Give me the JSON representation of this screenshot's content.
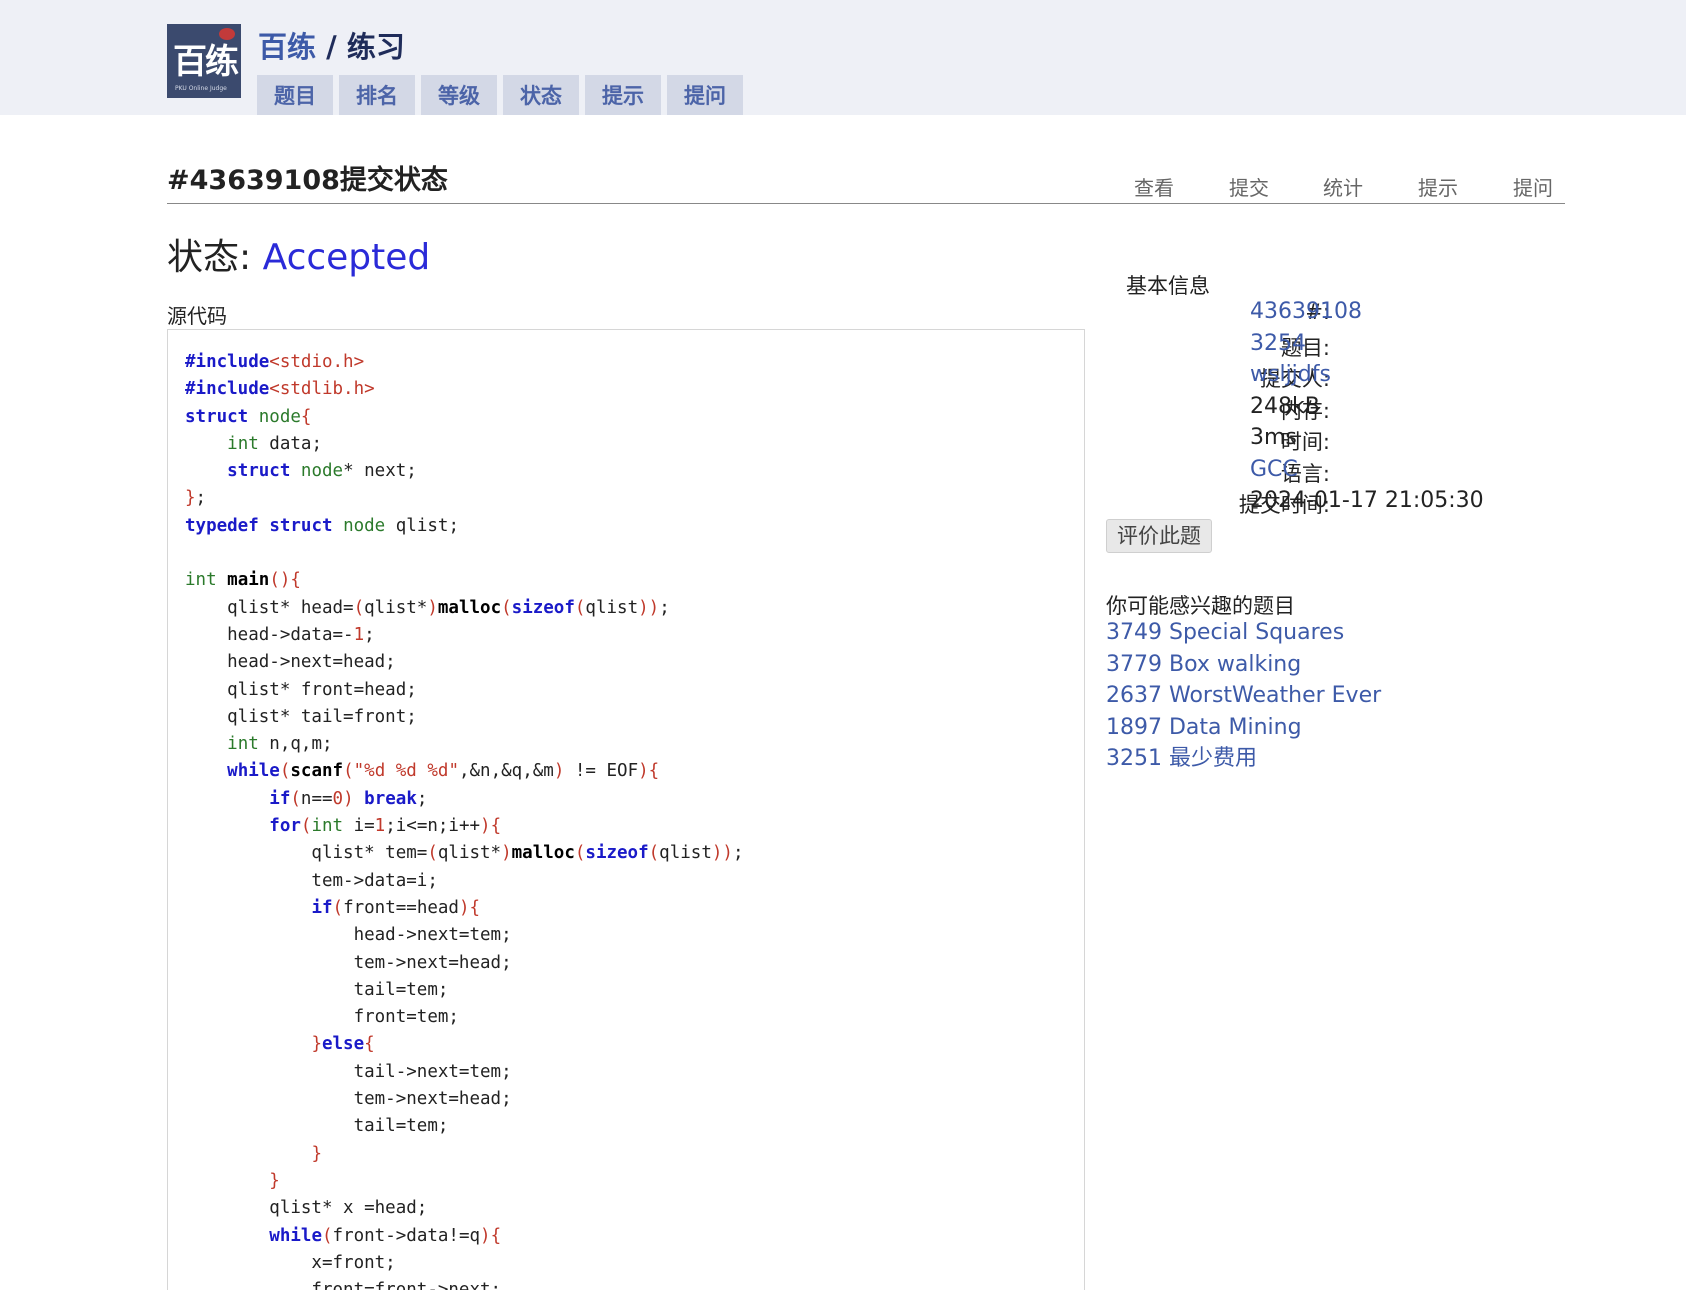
{
  "header": {
    "logo_text": "百练",
    "logo_sub": "PKU Online Judge",
    "title_brand": "百练",
    "title_sep": " / ",
    "title_section": "练习",
    "nav": [
      "题目",
      "排名",
      "等级",
      "状态",
      "提示",
      "提问"
    ]
  },
  "page": {
    "title": "#43639108提交状态",
    "sub_nav": [
      "查看",
      "提交",
      "统计",
      "提示",
      "提问"
    ],
    "status_label": "状态: ",
    "status_value": "Accepted",
    "source_label": "源代码"
  },
  "info": {
    "heading": "基本信息",
    "rows": [
      {
        "label": "#:",
        "value": "43639108",
        "link": true
      },
      {
        "label": "题目:",
        "value": "3254",
        "link": true
      },
      {
        "label": "提交人:",
        "value": "wsljjdfs",
        "link": true
      },
      {
        "label": "内存:",
        "value": "248kB",
        "link": false
      },
      {
        "label": "时间:",
        "value": "3ms",
        "link": false
      },
      {
        "label": "语言:",
        "value": "GCC",
        "link": true
      },
      {
        "label": "提交时间:",
        "value": "2024-01-17 21:05:30",
        "link": false
      }
    ],
    "rate_button": "评价此题"
  },
  "recommend": {
    "heading": "你可能感兴趣的题目",
    "items": [
      "3749 Special Squares",
      "3779 Box walking",
      "2637 WorstWeather Ever",
      "1897 Data Mining",
      "3251 最少费用"
    ]
  },
  "code_lines": [
    "#include<stdio.h>",
    "#include<stdlib.h>",
    "struct node{",
    "    int data;",
    "    struct node* next;",
    "};",
    "typedef struct node qlist;",
    "",
    "int main(){",
    "    qlist* head=(qlist*)malloc(sizeof(qlist));",
    "    head->data=-1;",
    "    head->next=head;",
    "    qlist* front=head;",
    "    qlist* tail=front;",
    "    int n,q,m;",
    "    while(scanf(\"%d %d %d\",&n,&q,&m) != EOF){",
    "        if(n==0) break;",
    "        for(int i=1;i<=n;i++){",
    "            qlist* tem=(qlist*)malloc(sizeof(qlist));",
    "            tem->data=i;",
    "            if(front==head){",
    "                head->next=tem;",
    "                tem->next=head;",
    "                tail=tem;",
    "                front=tem;",
    "            }else{",
    "                tail->next=tem;",
    "                tem->next=head;",
    "                tail=tem;",
    "            }",
    "        }",
    "        qlist* x =head;",
    "        while(front->data!=q){",
    "            x=front;",
    "            front=front->next;"
  ]
}
